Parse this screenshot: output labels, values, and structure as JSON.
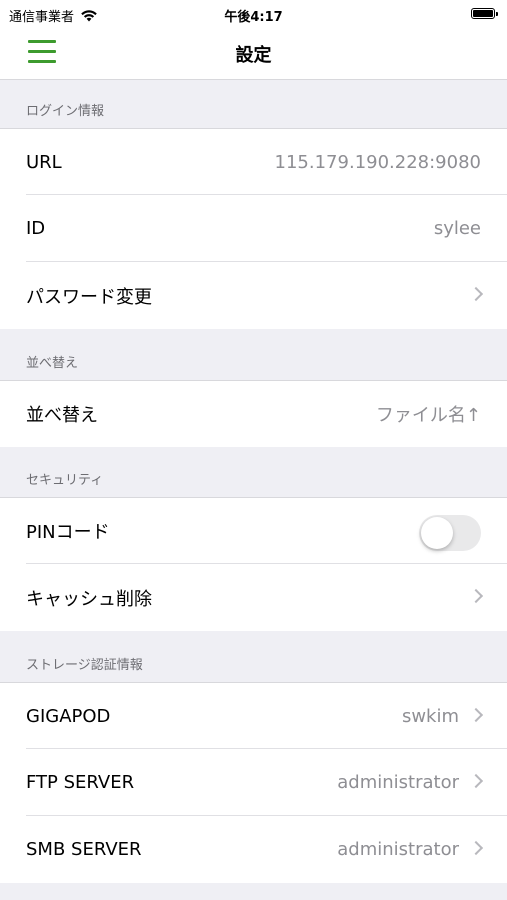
{
  "status_bar": {
    "carrier": "通信事業者",
    "time": "午後4:17",
    "icons": [
      "wifi-icon",
      "battery-icon"
    ]
  },
  "nav": {
    "title": "設定",
    "menu_icon": "hamburger-menu-icon",
    "accent_color": "#3d9b2e"
  },
  "sections": [
    {
      "header": "ログイン情報",
      "rows": [
        {
          "label": "URL",
          "value": "115.179.190.228:9080"
        },
        {
          "label": "ID",
          "value": "sylee"
        },
        {
          "label": "パスワード変更",
          "value": ""
        }
      ]
    },
    {
      "header": "並べ替え",
      "rows": [
        {
          "label": "並べ替え",
          "value": "ファイル名↑"
        }
      ]
    },
    {
      "header": "セキュリティ",
      "rows": [
        {
          "label": "PINコード",
          "toggle_on": false
        },
        {
          "label": "キャッシュ削除",
          "value": ""
        }
      ]
    },
    {
      "header": "ストレージ認証情報",
      "rows": [
        {
          "label": "GIGAPOD",
          "value": "swkim"
        },
        {
          "label": "FTP SERVER",
          "value": "administrator"
        },
        {
          "label": "SMB SERVER",
          "value": "administrator"
        }
      ]
    }
  ]
}
